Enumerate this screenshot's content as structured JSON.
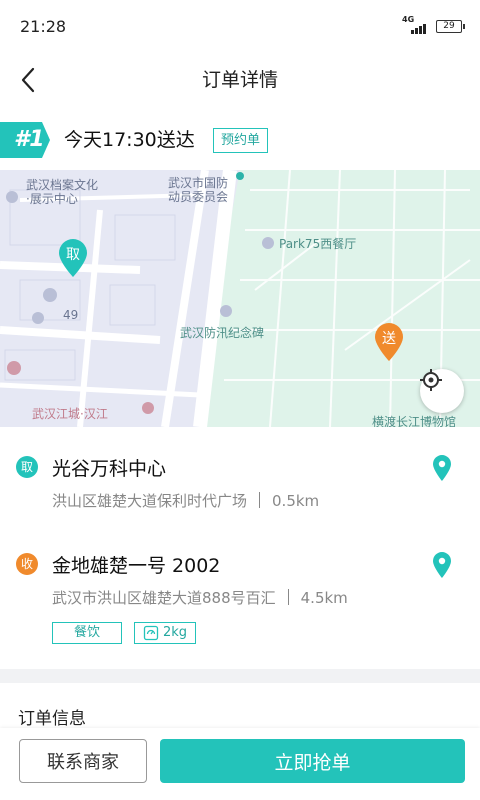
{
  "status_bar": {
    "time": "21:28",
    "network": "4G",
    "battery": "29"
  },
  "header": {
    "title": "订单详情"
  },
  "order": {
    "number": "#1",
    "delivery_time": "今天17:30送达",
    "badge": "预约单"
  },
  "map": {
    "labels": {
      "archive": "武汉档案文化\n·展示中心",
      "defense": "武汉市国防\n动员委员会",
      "restaurant": "Park75西餐厅",
      "monument": "武汉防汛纪念碑",
      "number49": "49",
      "jianghan": "武汉江城·汉江",
      "museum": "横渡长江博物馆"
    },
    "pickup_marker": "取",
    "delivery_marker": "送"
  },
  "pickup": {
    "badge": "取",
    "name": "光谷万科中心",
    "address": "洪山区雄楚大道保利时代广场",
    "distance": "0.5km"
  },
  "delivery": {
    "badge": "收",
    "name": "金地雄楚一号 2002",
    "address": "武汉市洪山区雄楚大道888号百汇",
    "distance": "4.5km"
  },
  "tags": {
    "category": "餐饮",
    "weight": "2kg"
  },
  "order_info": {
    "title": "订单信息"
  },
  "actions": {
    "contact": "联系商家",
    "grab": "立即抢单"
  },
  "colors": {
    "accent": "#23c3ba",
    "orange": "#f08a2c",
    "map_green": "#dff3ea",
    "map_base": "#e6e8f4"
  }
}
